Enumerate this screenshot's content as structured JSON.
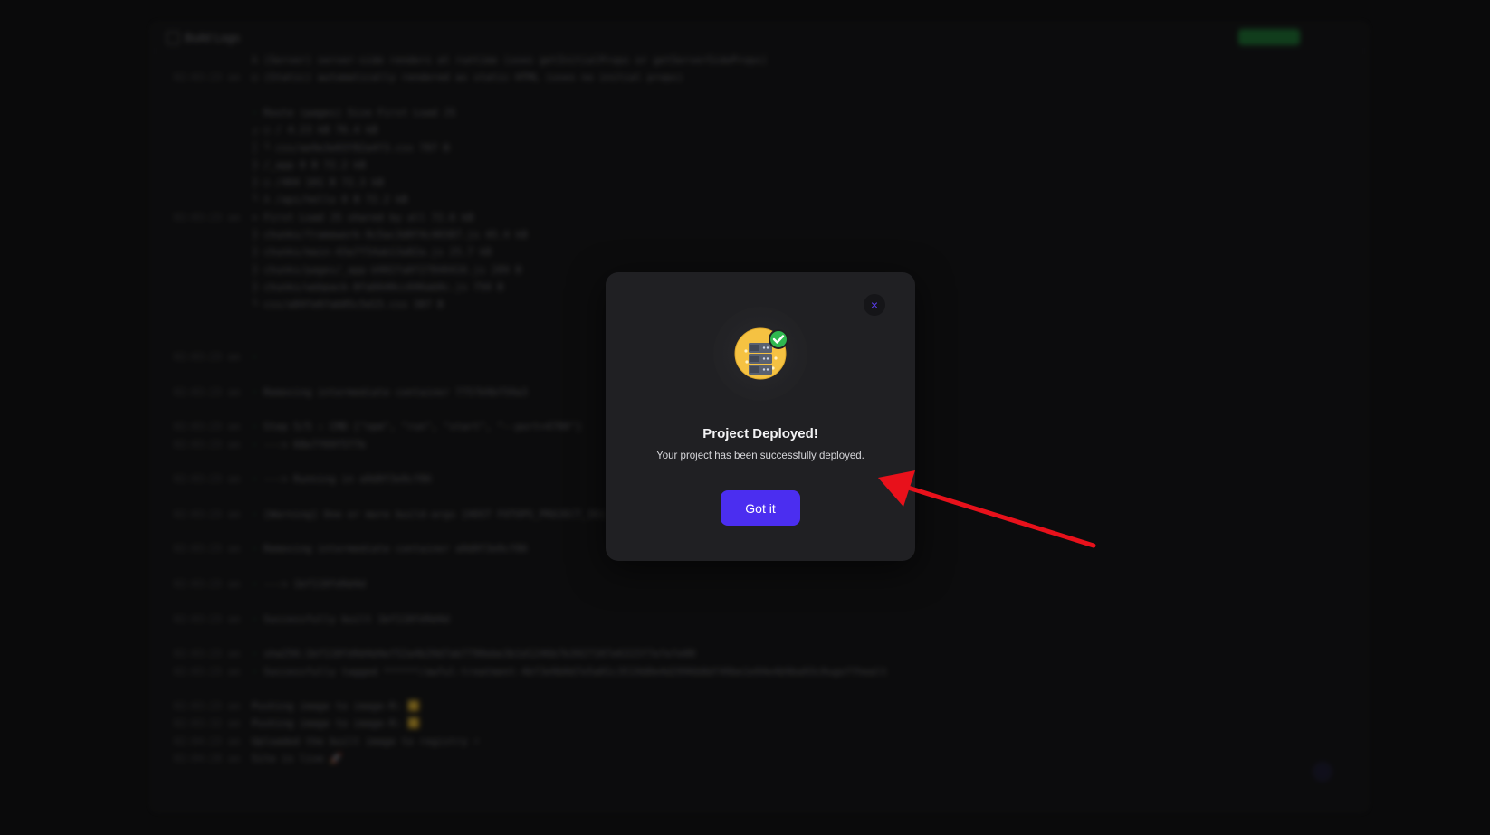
{
  "background": {
    "panel_title": "Build Logs",
    "log_lines": [
      {
        "ts": "",
        "text": "λ  (Server)  server-side renders at runtime (uses getInitialProps or getServerSideProps)",
        "mark": ""
      },
      {
        "ts": "02:03:23 am",
        "text": "○  (Static)  automatically rendered as static HTML (uses no initial props)",
        "mark": ""
      },
      {
        "ts": "",
        "text": "",
        "mark": ""
      },
      {
        "ts": "",
        "text": "Route (pages)                              Size     First Load JS",
        "mark": "·"
      },
      {
        "ts": "",
        "text": "┌ ○ /                                      4.23 kB        76.4 kB",
        "mark": ""
      },
      {
        "ts": "",
        "text": "│   └ css/ae9e3e03f82a4f3.css              787 B",
        "mark": ""
      },
      {
        "ts": "",
        "text": "├   /_app                                  0 B            72.2 kB",
        "mark": ""
      },
      {
        "ts": "",
        "text": "├ ○ /404                                   181 B          72.3 kB",
        "mark": ""
      },
      {
        "ts": "",
        "text": "└ λ /api/hello                             0 B            72.2 kB",
        "mark": ""
      },
      {
        "ts": "02:03:23 am",
        "text": "+ First Load JS shared by all               72.6 kB",
        "mark": ""
      },
      {
        "ts": "",
        "text": "  ├ chunks/framework-9c5ac3d0f4c40387.js   45.4 kB",
        "mark": ""
      },
      {
        "ts": "",
        "text": "  ├ chunks/main-43a7f54ab13a82a.js         25.7 kB",
        "mark": ""
      },
      {
        "ts": "",
        "text": "  ├ chunks/pages/_app-b902fa0f27840416.js  289 B",
        "mark": ""
      },
      {
        "ts": "",
        "text": "  ├ chunks/webpack-8fa6640cc696ab0c.js     750 B",
        "mark": ""
      },
      {
        "ts": "",
        "text": "  └ css/a84fe6fab05c5d15.css               387 B",
        "mark": ""
      },
      {
        "ts": "",
        "text": "",
        "mark": ""
      },
      {
        "ts": "",
        "text": "",
        "mark": ""
      },
      {
        "ts": "02:03:23 am",
        "text": "",
        "mark": "·"
      },
      {
        "ts": "",
        "text": "",
        "mark": ""
      },
      {
        "ts": "02:03:23 am",
        "text": "Removing intermediate container 7757b9bf59a3",
        "mark": "·"
      },
      {
        "ts": "",
        "text": "",
        "mark": ""
      },
      {
        "ts": "02:03:23 am",
        "text": "Step 5/5 : CMD [\"npm\", \"run\", \"start\", \"--port=4700\"]",
        "mark": "·"
      },
      {
        "ts": "02:03:23 am",
        "text": " ---> 68e7f69f577b",
        "mark": "·"
      },
      {
        "ts": "",
        "text": "",
        "mark": ""
      },
      {
        "ts": "02:03:23 am",
        "text": " ---> Running in a9d0f3e9cf86",
        "mark": "·"
      },
      {
        "ts": "",
        "text": "",
        "mark": ""
      },
      {
        "ts": "02:03:23 am",
        "text": "[Warning] One or more build-args [HOST FOTOPS_PROJECT_ID] were not consumed",
        "mark": "·"
      },
      {
        "ts": "",
        "text": "",
        "mark": ""
      },
      {
        "ts": "02:03:23 am",
        "text": "Removing intermediate container a9d0f3e9cf86",
        "mark": "·"
      },
      {
        "ts": "",
        "text": "",
        "mark": ""
      },
      {
        "ts": "02:03:23 am",
        "text": " ---> 1bf118fd9d4d",
        "mark": "·"
      },
      {
        "ts": "",
        "text": "",
        "mark": ""
      },
      {
        "ts": "02:03:23 am",
        "text": "Successfully built 1bf118fd9d4d",
        "mark": "·"
      },
      {
        "ts": "",
        "text": "",
        "mark": ""
      },
      {
        "ts": "02:03:23 am",
        "text": "sha256:1bf118fd9d4d4ef52a4b29d7ab7790ebe3b1d1246b7b3927107e6315f7efefe00",
        "mark": "·"
      },
      {
        "ts": "02:03:23 am",
        "text": "Successfully tagged ******/awful-treatment-4bf3e9b0d7e5a01c3519d0e4d2996b8df49be1e94e4b9ba93c0ugoffhealt",
        "mark": "·"
      },
      {
        "ts": "",
        "text": "",
        "mark": ""
      },
      {
        "ts": "02:03:23 am",
        "text": "  Pushing image to image-R: 🟨",
        "mark": ""
      },
      {
        "ts": "02:03:32 am",
        "text": "  Pushing image to image-R: 🟨",
        "mark": ""
      },
      {
        "ts": "02:04:23 am",
        "text": "  Uploaded the built image to registry ⚡",
        "mark": ""
      },
      {
        "ts": "02:04:28 am",
        "text": "  Site is live 🚀",
        "mark": ""
      }
    ]
  },
  "modal": {
    "close_icon": "×",
    "title": "Project Deployed!",
    "message": "Your project has been successfully deployed.",
    "button_label": "Got it",
    "illustration": "server-deployed-icon"
  },
  "annotation": {
    "arrow_color": "#e8111b"
  },
  "colors": {
    "accent": "#4b2ef0",
    "success": "#2fb84f"
  }
}
